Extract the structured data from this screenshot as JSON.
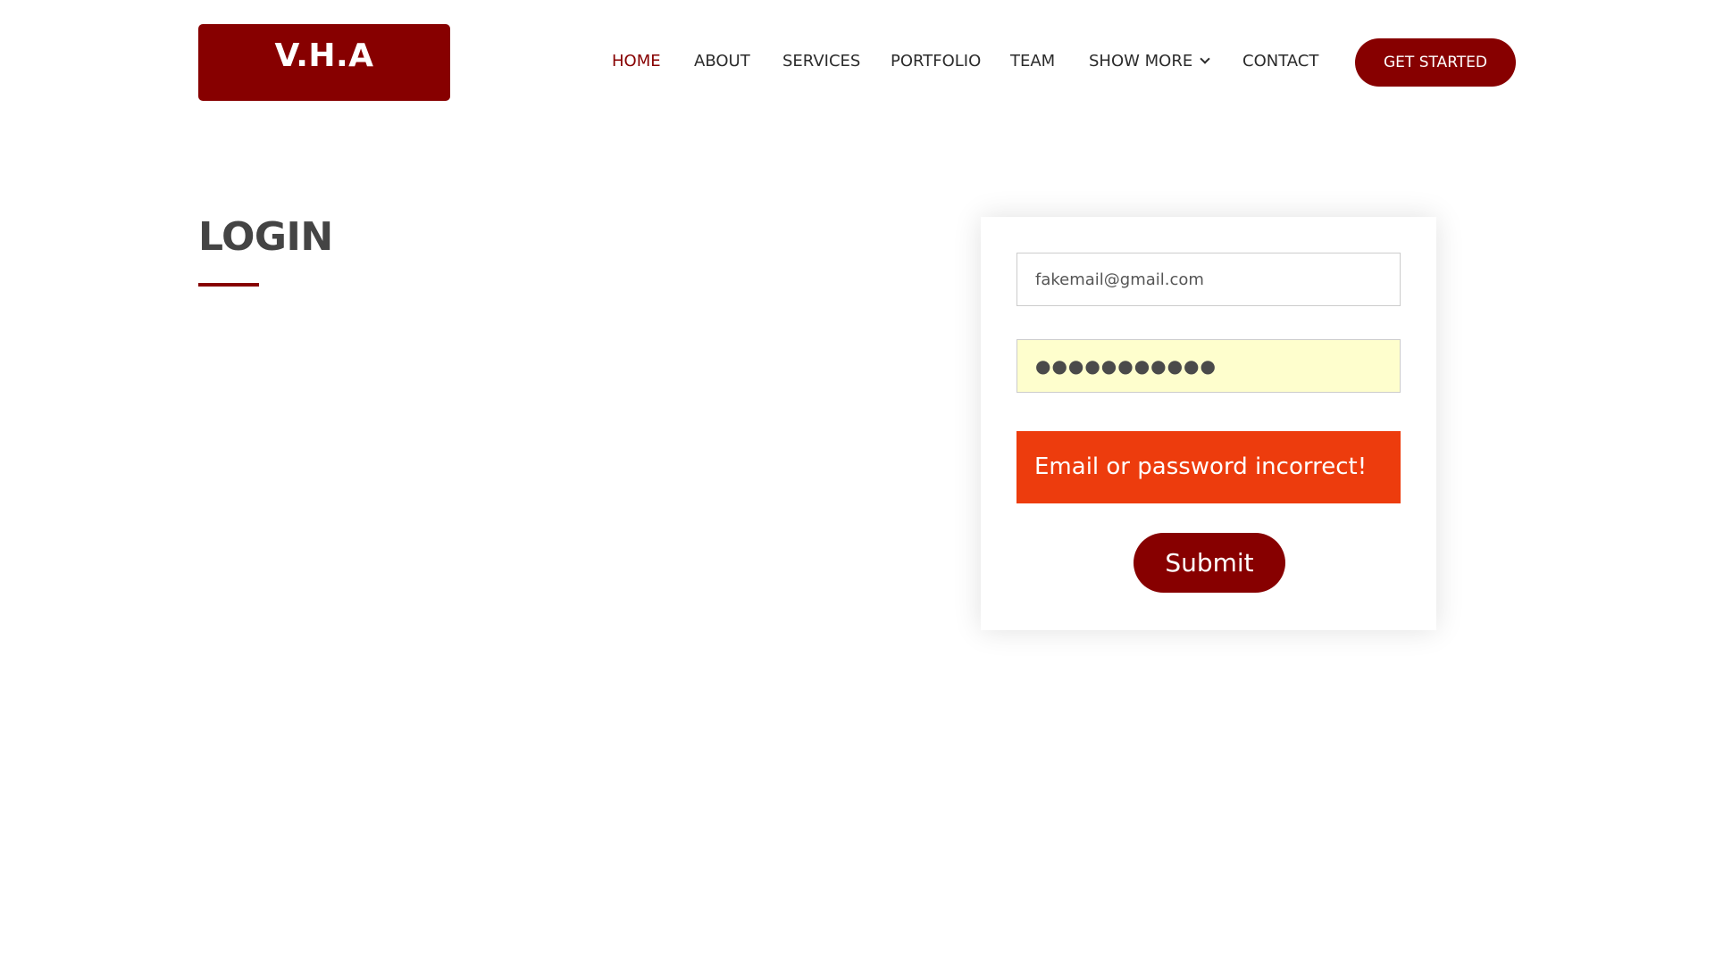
{
  "header": {
    "logo_text": "V.H.A",
    "nav": [
      {
        "label": "HOME",
        "active": true
      },
      {
        "label": "ABOUT"
      },
      {
        "label": "SERVICES"
      },
      {
        "label": "PORTFOLIO"
      },
      {
        "label": "TEAM"
      },
      {
        "label": "SHOW MORE"
      },
      {
        "label": "CONTACT"
      }
    ],
    "cta_label": "GET STARTED"
  },
  "section": {
    "title": "LOGIN"
  },
  "form": {
    "email_value": "fakemail@gmail.com",
    "password_display": "●●●●●●●●●●●",
    "error_message": "Email or password incorrect!",
    "submit_label": "Submit"
  },
  "colors": {
    "brand": "#870000",
    "error": "#ed3c0d",
    "autofill": "#fefecd",
    "text": "#444444"
  },
  "icons": {
    "show_more": "chevron-down-icon"
  }
}
